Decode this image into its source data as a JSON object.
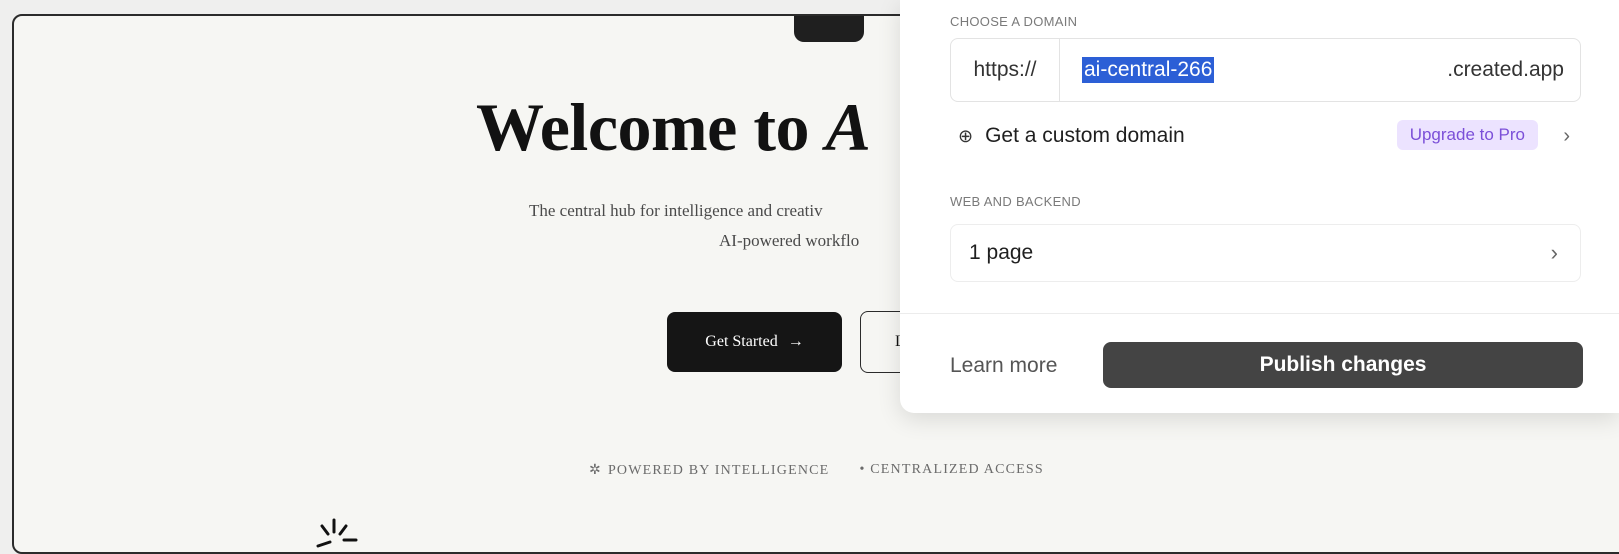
{
  "hero": {
    "title_prefix": "Welcome to ",
    "title_accent": "A",
    "subtitle_line1": "The central hub for intelligence and creativ",
    "subtitle_line2": "AI-powered workflo",
    "get_started_label": "Get Started",
    "get_started_icon": "arrow-right-icon",
    "secondary_label": "Le"
  },
  "features": {
    "item1_icon": "sparkle-icon",
    "item1": "POWERED BY INTELLIGENCE",
    "item2": "• CENTRALIZED ACCESS"
  },
  "publish_panel": {
    "domain_section_label": "CHOOSE A DOMAIN",
    "domain_prefix": "https://",
    "domain_value": "ai-central-266",
    "domain_suffix": ".created.app",
    "custom_domain_label": "Get a custom domain",
    "custom_domain_icon": "globe-icon",
    "upgrade_badge": "Upgrade to Pro",
    "web_section_label": "WEB AND BACKEND",
    "pages_label": "1 page",
    "learn_more": "Learn more",
    "publish_button": "Publish changes"
  },
  "colors": {
    "primary_button": "#151515",
    "selection": "#2c5fd6",
    "pro_badge_bg": "#ece3ff",
    "pro_badge_text": "#7b4fd8",
    "publish_button": "#444444"
  }
}
